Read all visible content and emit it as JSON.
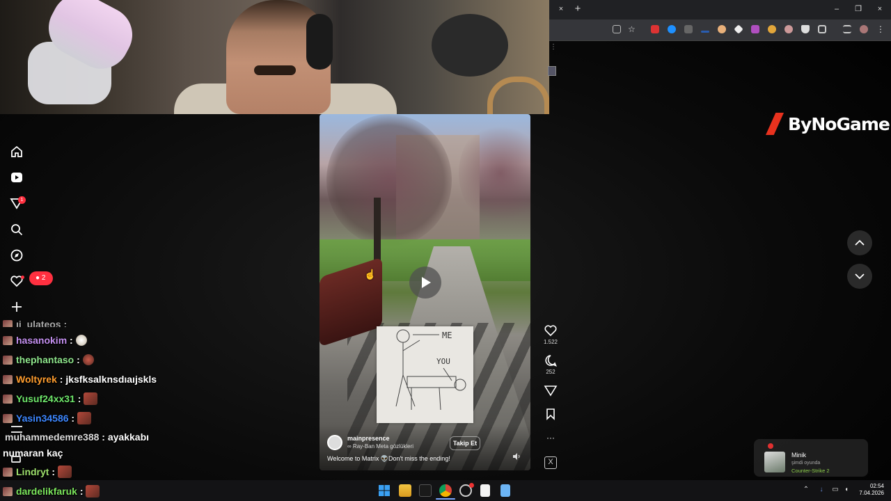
{
  "browser": {
    "tab_close": "×",
    "new_tab": "+",
    "window_buttons": [
      "–",
      "❐",
      "×"
    ],
    "bookmark_more": "⋮"
  },
  "sidebar": {
    "notification_count": "1",
    "live_badge_count": "2"
  },
  "chat": {
    "partial_line": "ıi_ulateos :",
    "messages": [
      {
        "user": "hasanokim",
        "sep": " : ",
        "text": "",
        "color": "#c490f0",
        "emote": "small"
      },
      {
        "user": "thephantaso",
        "sep": " : ",
        "text": "",
        "color": "#8fe68c",
        "emote": "small"
      },
      {
        "user": "Woltyrek",
        "sep": " : ",
        "text": "jksfksalknsdıaıjskls",
        "color": "#ff9d2e",
        "emote": ""
      },
      {
        "user": "Yusuf24xx31",
        "sep": " : ",
        "text": "",
        "color": "#6fe86b",
        "emote": "box"
      },
      {
        "user": "Yasin34586",
        "sep": " : ",
        "text": "",
        "color": "#3d87ff",
        "emote": "box"
      },
      {
        "user": "muhammedemre388",
        "sep": " : ",
        "text": "ayakkabı",
        "color": "#dcdcdc",
        "emote": ""
      },
      {
        "user": "",
        "sep": "",
        "text": "numaran kaç",
        "color": "#ffffff",
        "emote": ""
      },
      {
        "user": "Lindryt",
        "sep": " : ",
        "text": "",
        "color": "#9ee06c",
        "emote": "box"
      },
      {
        "user": "dardelikfaruk",
        "sep": " : ",
        "text": "",
        "color": "#7be55c",
        "emote": "box"
      }
    ]
  },
  "video": {
    "paper_me": "ME",
    "paper_you": "YOU",
    "username": "mainpresence",
    "subtitle": "∞ Ray-Ban Meta gözlükleri",
    "follow_label": "Takip Et",
    "caption": "Welcome to Matrix 👽Don't miss the ending!"
  },
  "actions": {
    "likes": "1.522",
    "comments": "252",
    "more": "···"
  },
  "logo": {
    "text": "ByNoGame"
  },
  "game_notification": {
    "name": "Minik",
    "status": "şimdi oyunda",
    "game": "Counter-Strike 2"
  },
  "taskbar": {
    "time": "02:54",
    "date": "7.04.2026"
  },
  "colors": {
    "accent": "#ff3040",
    "logo_red": "#e8321e",
    "game_green": "#8ecf4c"
  }
}
